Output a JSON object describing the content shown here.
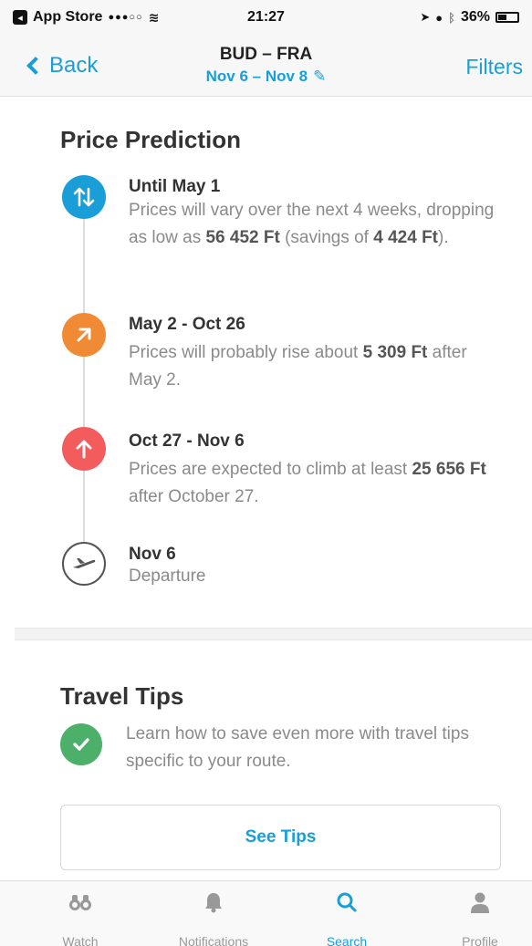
{
  "status_bar": {
    "carrier": "App Store",
    "signal": "●●●○○",
    "time": "21:27",
    "battery": "36%"
  },
  "nav": {
    "back_label": "Back",
    "route": "BUD – FRA",
    "dates": "Nov 6 – Nov 8",
    "filters_label": "Filters"
  },
  "price_prediction": {
    "title": "Price Prediction",
    "steps": [
      {
        "title": "Until May 1",
        "text_pre": "Prices will vary over the next 4 weeks, dropping as low as ",
        "amount": "56 452 Ft",
        "text_mid": " (savings of ",
        "amount2": "4 424 Ft",
        "text_post": ").",
        "icon": "up-down-arrows-icon",
        "color": "#1a9ed8"
      },
      {
        "title": "May 2 - Oct 26",
        "text_pre": "Prices will probably rise about ",
        "amount": "5 309 Ft",
        "text_post": " after May 2.",
        "icon": "arrow-up-right-icon",
        "color": "#f08a35"
      },
      {
        "title": "Oct 27 - Nov 6",
        "text_pre": "Prices are expected to climb at least ",
        "amount": "25 656 Ft",
        "text_post": " after October 27.",
        "icon": "arrow-up-icon",
        "color": "#f25c5c"
      },
      {
        "title": "Nov 6",
        "text": "Departure",
        "icon": "airplane-icon"
      }
    ]
  },
  "travel_tips": {
    "title": "Travel Tips",
    "text": "Learn how to save even more with travel tips specific to your route.",
    "button_label": "See Tips",
    "icon": "check-icon",
    "color": "#4caf6a"
  },
  "tabbar": {
    "tabs": [
      {
        "label": "Watch",
        "icon": "binoculars-icon"
      },
      {
        "label": "Notifications",
        "icon": "bell-icon"
      },
      {
        "label": "Search",
        "icon": "search-icon",
        "active": true
      },
      {
        "label": "Profile",
        "icon": "person-icon"
      }
    ]
  }
}
